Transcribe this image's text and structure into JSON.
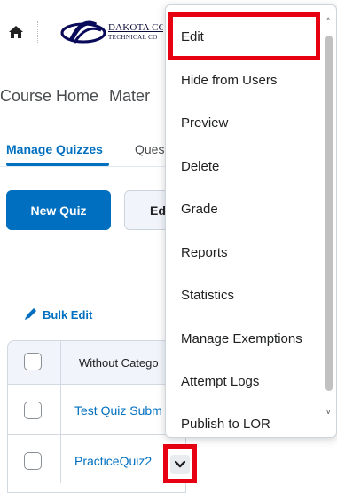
{
  "header": {
    "logo_line1": "DAKOTA CO",
    "logo_line2": "TECHNICAL CO"
  },
  "nav": {
    "items": [
      "Course Home",
      "Mater"
    ]
  },
  "tabs": {
    "active": "Manage Quizzes",
    "second": "Ques"
  },
  "toolbar": {
    "new_quiz": "New Quiz",
    "edit_partial": "Ed"
  },
  "bulk_edit": "Bulk Edit",
  "table": {
    "header": "Without Catego",
    "rows": [
      "Test Quiz Subm",
      "PracticeQuiz2"
    ]
  },
  "menu": {
    "items": [
      "Edit",
      "Hide from Users",
      "Preview",
      "Delete",
      "Grade",
      "Reports",
      "Statistics",
      "Manage Exemptions",
      "Attempt Logs",
      "Publish to LOR"
    ]
  },
  "colors": {
    "accent": "#006fbf",
    "highlight": "#e60012"
  }
}
